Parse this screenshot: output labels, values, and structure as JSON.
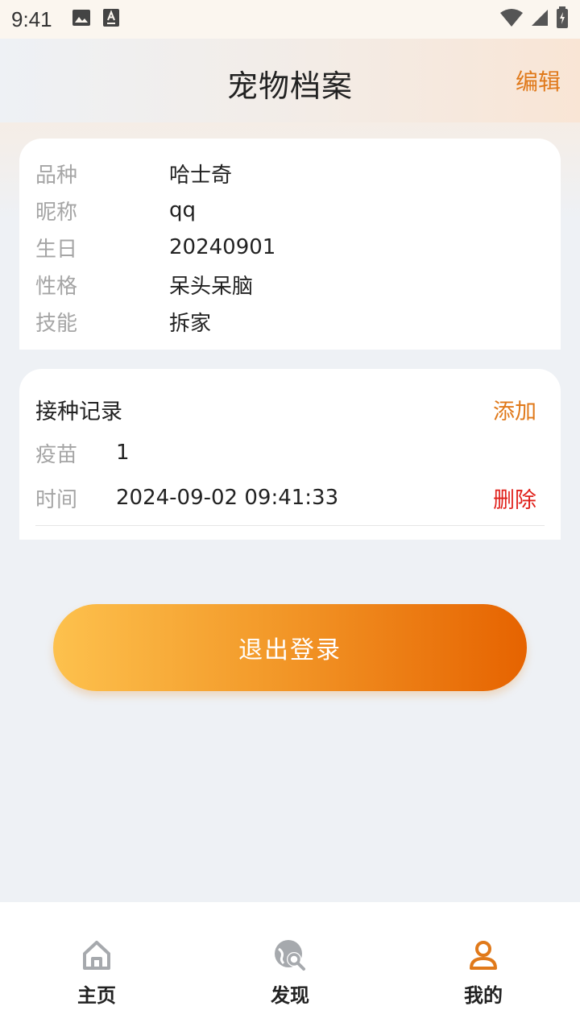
{
  "status_bar": {
    "time": "9:41"
  },
  "header": {
    "title": "宠物档案",
    "edit_label": "编辑"
  },
  "pet_info": {
    "rows": [
      {
        "label": "品种",
        "value": "哈士奇"
      },
      {
        "label": "昵称",
        "value": "qq"
      },
      {
        "label": "生日",
        "value": "20240901"
      },
      {
        "label": "性格",
        "value": "呆头呆脑"
      },
      {
        "label": "技能",
        "value": "拆家"
      }
    ]
  },
  "vaccination": {
    "title": "接种记录",
    "add_label": "添加",
    "records": [
      {
        "vaccine_label": "疫苗",
        "vaccine_value": "1",
        "time_label": "时间",
        "time_value": "2024-09-02 09:41:33",
        "delete_label": "删除"
      }
    ]
  },
  "logout_label": "退出登录",
  "tabs": [
    {
      "label": "主页",
      "icon": "home-icon",
      "active": false
    },
    {
      "label": "发现",
      "icon": "discover-icon",
      "active": false
    },
    {
      "label": "我的",
      "icon": "profile-icon",
      "active": true
    }
  ],
  "colors": {
    "accent": "#e0791a",
    "danger": "#e0201a",
    "inactive_icon": "#a6a9ad"
  }
}
